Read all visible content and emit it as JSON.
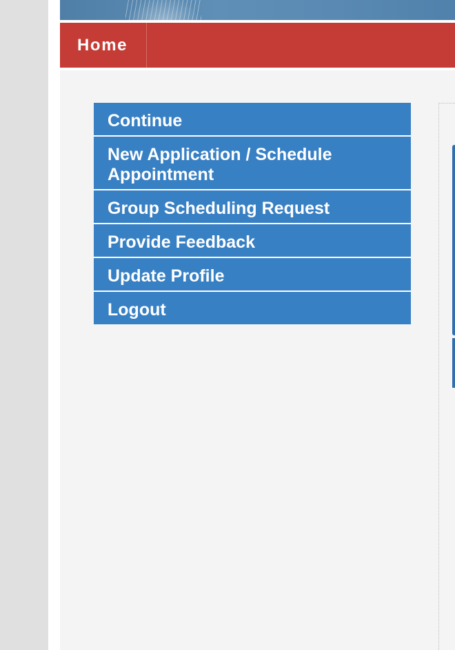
{
  "nav": {
    "home_label": "Home"
  },
  "menu": {
    "items": [
      {
        "label": "Continue"
      },
      {
        "label": "New Application / Schedule Appointment"
      },
      {
        "label": "Group Scheduling Request"
      },
      {
        "label": "Provide Feedback"
      },
      {
        "label": "Update Profile"
      },
      {
        "label": "Logout"
      }
    ]
  },
  "colors": {
    "nav_bar": "#c43c35",
    "menu_button": "#3880c4",
    "content_background": "#f4f4f4",
    "left_gutter": "#e0e0e0"
  }
}
